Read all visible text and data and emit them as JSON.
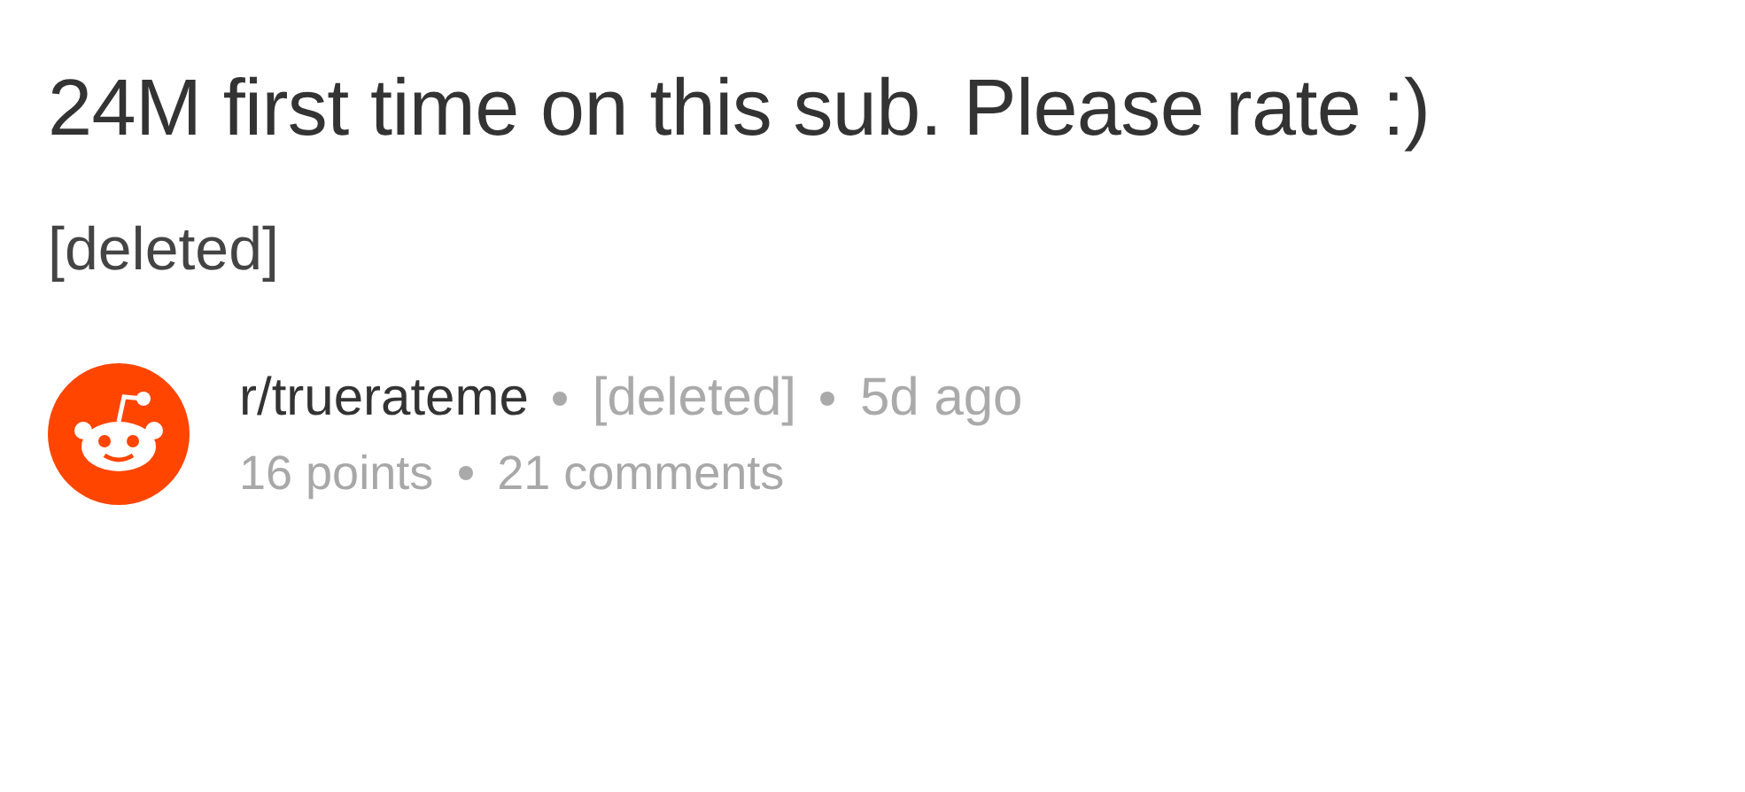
{
  "post": {
    "title": "24M first time on this sub. Please rate :)",
    "author": "[deleted]"
  },
  "footer": {
    "subreddit": "r/truerateme",
    "author": "[deleted]",
    "age": "5d ago",
    "points": "16 points",
    "comments": "21 comments"
  }
}
